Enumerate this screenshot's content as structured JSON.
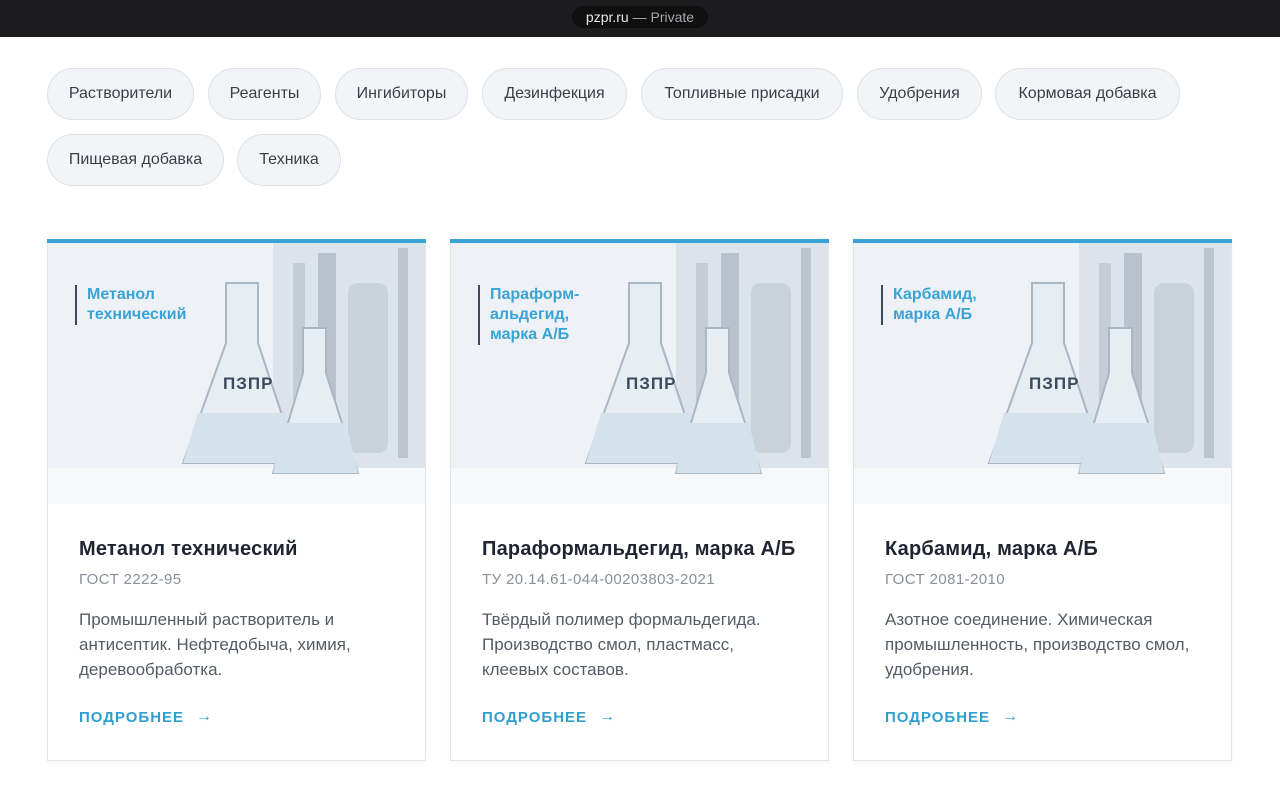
{
  "browser": {
    "domain": "pzpr.ru",
    "mode": "— Private"
  },
  "categories": [
    "Растворители",
    "Реагенты",
    "Ингибиторы",
    "Дезинфекция",
    "Топливные присадки",
    "Удобрения",
    "Кормовая добавка",
    "Пищевая добавка",
    "Техника"
  ],
  "products": [
    {
      "image_label": [
        "Метанол",
        "технический"
      ],
      "brand": "ПЗПР",
      "title": "Метанол технический",
      "standard": "ГОСТ 2222-95",
      "description": "Промышленный растворитель и антисептик. Нефтедобыча, химия, деревообработка.",
      "more_label": "ПОДРОБНЕЕ"
    },
    {
      "image_label": [
        "Параформ-",
        "альдегид,",
        "марка А/Б"
      ],
      "brand": "ПЗПР",
      "title": "Параформальдегид, марка А/Б",
      "standard": "ТУ 20.14.61-044-00203803-2021",
      "description": "Твёрдый полимер формальдегида. Производство смол, пластмасс, клеевых составов.",
      "more_label": "ПОДРОБНЕЕ"
    },
    {
      "image_label": [
        "Карбамид,",
        "марка А/Б"
      ],
      "brand": "ПЗПР",
      "title": "Карбамид, марка А/Б",
      "standard": "ГОСТ 2081-2010",
      "description": "Азотное соединение. Химическая промышленность, производство смол, удобрения.",
      "more_label": "ПОДРОБНЕЕ"
    }
  ],
  "colors": {
    "accent": "#3aa3d6",
    "text": "#1f2430",
    "muted": "#8a8f98"
  },
  "icons": {
    "more": "arrow-right-icon"
  }
}
